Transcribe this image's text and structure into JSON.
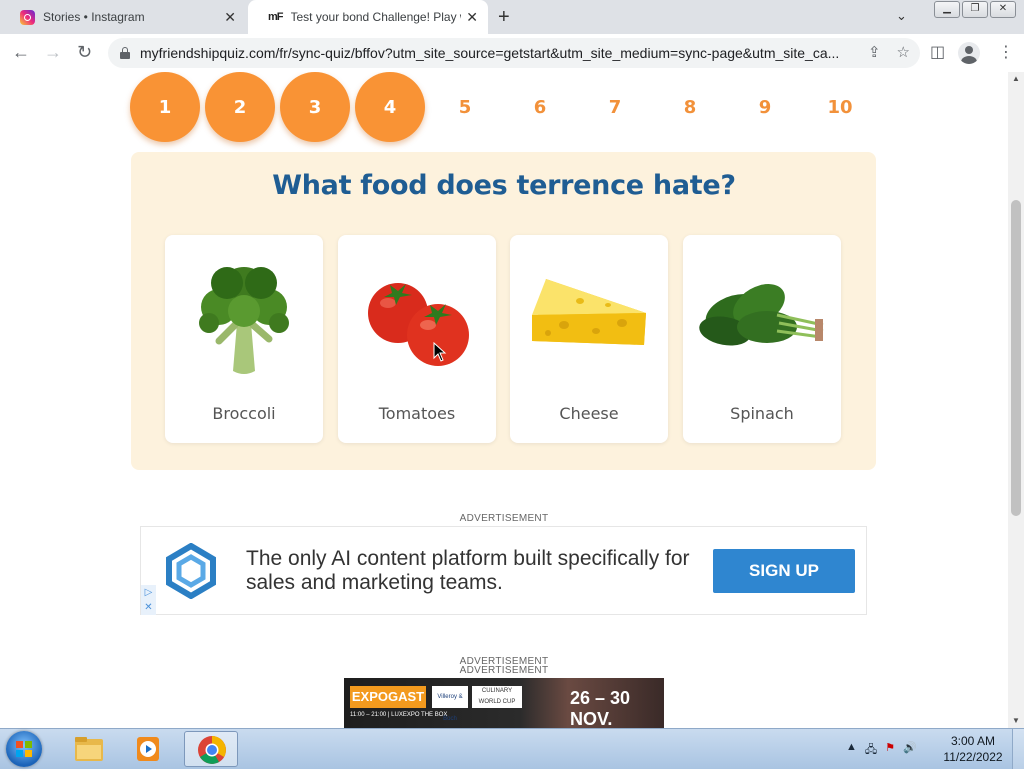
{
  "browser": {
    "tabs": [
      {
        "title": "Stories • Instagram",
        "favicon": "instagram-icon"
      },
      {
        "title": "Test your bond Challenge! Play w",
        "favicon": "mf"
      }
    ],
    "url": "myfriendshipquiz.com/fr/sync-quiz/bffov?utm_site_source=getstart&utm_site_medium=sync-page&utm_site_ca..."
  },
  "quiz": {
    "steps": [
      "1",
      "2",
      "3",
      "4",
      "5",
      "6",
      "7",
      "8",
      "9",
      "10"
    ],
    "steps_completed": 4,
    "question": "What food does terrence hate?",
    "options": [
      {
        "label": "Broccoli",
        "icon": "broccoli-icon"
      },
      {
        "label": "Tomatoes",
        "icon": "tomatoes-icon"
      },
      {
        "label": "Cheese",
        "icon": "cheese-icon"
      },
      {
        "label": "Spinach",
        "icon": "spinach-icon"
      }
    ]
  },
  "ads": {
    "label": "ADVERTISEMENT",
    "banner_text": "The only AI content platform built specifically for sales and marketing teams.",
    "banner_button": "SIGN UP",
    "label2_a": "ADVERTISEMENT",
    "label2_b": "ADVERTISEMENT",
    "expo_title": "EXPOGAST",
    "expo_sub": "11:00 – 21:00 | LUXEXPO THE BOX",
    "expo_sponsor": "Villeroy & Boch",
    "expo_cup": "CULINARY WORLD CUP",
    "expo_dates": "26 – 30 NOV."
  },
  "taskbar": {
    "time": "3:00 AM",
    "date": "11/22/2022"
  },
  "colors": {
    "accent_orange": "#f99335",
    "question_blue": "#1f5d93",
    "quiz_bg": "#fdf2dd",
    "ad_button": "#2f86d0"
  }
}
